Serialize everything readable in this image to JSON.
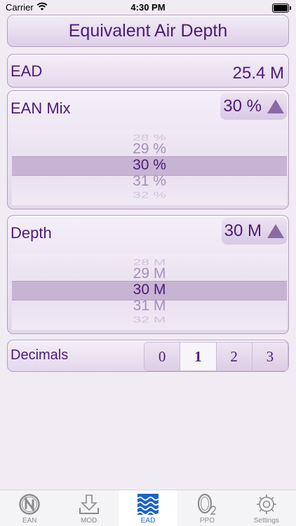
{
  "status": {
    "carrier": "Carrier",
    "time": "4:30 PM"
  },
  "header": {
    "title": "Equivalent Air Depth"
  },
  "ead": {
    "label": "EAD",
    "value": "25.4 M"
  },
  "mix": {
    "label": "EAN Mix",
    "selected": "30 %",
    "picker": [
      "28 %",
      "29 %",
      "30 %",
      "31 %",
      "32 %"
    ]
  },
  "depth": {
    "label": "Depth",
    "selected": "30 M",
    "picker": [
      "28 M",
      "29 M",
      "30 M",
      "31 M",
      "32 M"
    ]
  },
  "decimals": {
    "label": "Decimals",
    "options": [
      "0",
      "1",
      "2",
      "3"
    ],
    "selected_index": 1
  },
  "tabs": [
    {
      "label": "EAN",
      "icon": "n-circle-icon"
    },
    {
      "label": "MOD",
      "icon": "download-icon"
    },
    {
      "label": "EAD",
      "icon": "waves-icon",
      "active": true
    },
    {
      "label": "PPO",
      "icon": "o2-icon"
    },
    {
      "label": "Settings",
      "icon": "gear-icon"
    }
  ],
  "colors": {
    "accent": "#4e1a78",
    "tab_active": "#1e63c8"
  }
}
